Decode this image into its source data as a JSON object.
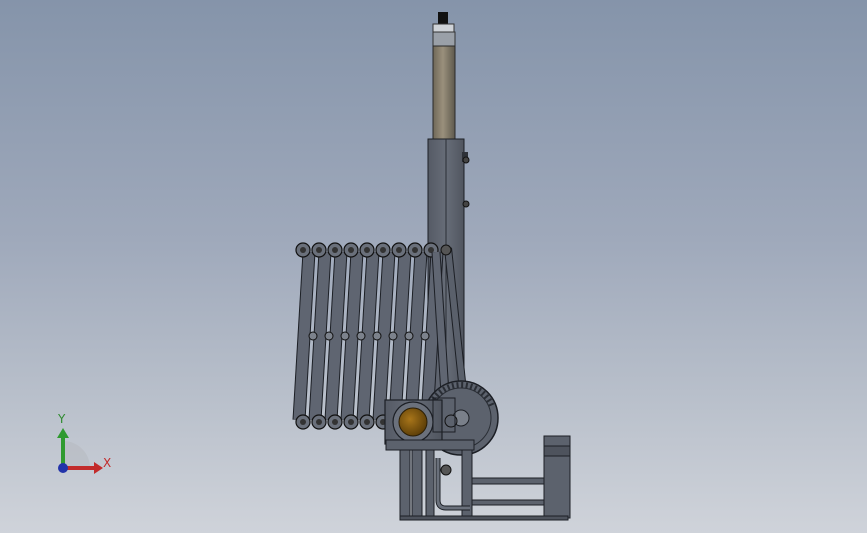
{
  "view": {
    "background_top": "#8594aa",
    "background_bottom": "#cfd3da",
    "part_color": "#5e6470",
    "edge_color": "#1c1f25",
    "shaft_color": "#8a7f6c",
    "bearing_color": "#7a5510"
  },
  "triad": {
    "y_label": "Y",
    "x_label": "X",
    "y_color": "#2f9a2f",
    "x_color": "#c22b2b",
    "origin_color": "#2233aa"
  }
}
